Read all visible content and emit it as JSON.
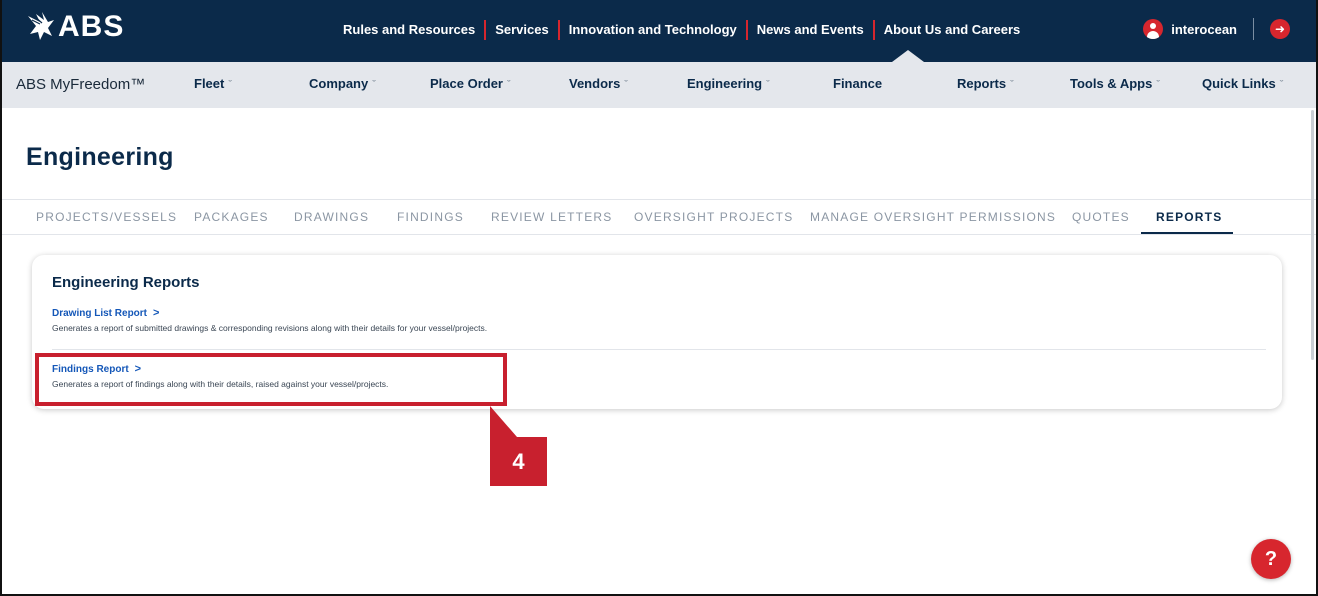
{
  "header": {
    "brand": "ABS",
    "links": [
      "Rules and Resources",
      "Services",
      "Innovation and Technology",
      "News and Events",
      "About Us and Careers"
    ],
    "username": "interocean"
  },
  "subnav": {
    "app_name": "ABS MyFreedom™",
    "items": [
      {
        "label": "Fleet",
        "has_menu": true
      },
      {
        "label": "Company",
        "has_menu": true
      },
      {
        "label": "Place Order",
        "has_menu": true
      },
      {
        "label": "Vendors",
        "has_menu": true
      },
      {
        "label": "Engineering",
        "has_menu": true
      },
      {
        "label": "Finance",
        "has_menu": false
      },
      {
        "label": "Reports",
        "has_menu": true
      },
      {
        "label": "Tools & Apps",
        "has_menu": true
      },
      {
        "label": "Quick Links",
        "has_menu": true
      }
    ],
    "caret": "ˇ"
  },
  "page": {
    "title": "Engineering",
    "tabs": [
      {
        "label": "PROJECTS/VESSELS",
        "active": false
      },
      {
        "label": "PACKAGES",
        "active": false
      },
      {
        "label": "DRAWINGS",
        "active": false
      },
      {
        "label": "FINDINGS",
        "active": false
      },
      {
        "label": "REVIEW LETTERS",
        "active": false
      },
      {
        "label": "OVERSIGHT PROJECTS",
        "active": false
      },
      {
        "label": "MANAGE OVERSIGHT PERMISSIONS",
        "active": false
      },
      {
        "label": "QUOTES",
        "active": false
      },
      {
        "label": "REPORTS",
        "active": true
      }
    ]
  },
  "card": {
    "title": "Engineering Reports",
    "reports": [
      {
        "label": "Drawing List Report",
        "arrow": ">",
        "description": "Generates a report of submitted drawings & corresponding revisions along with their details for your vessel/projects."
      },
      {
        "label": "Findings Report",
        "arrow": ">",
        "description": "Generates a report of findings along with their details, raised against your vessel/projects."
      }
    ]
  },
  "annotation": {
    "step": "4",
    "color": "#c8202e"
  },
  "help": {
    "label": "?"
  },
  "colors": {
    "navy": "#0b2a4a",
    "red": "#d7262e",
    "link": "#1457b8"
  }
}
